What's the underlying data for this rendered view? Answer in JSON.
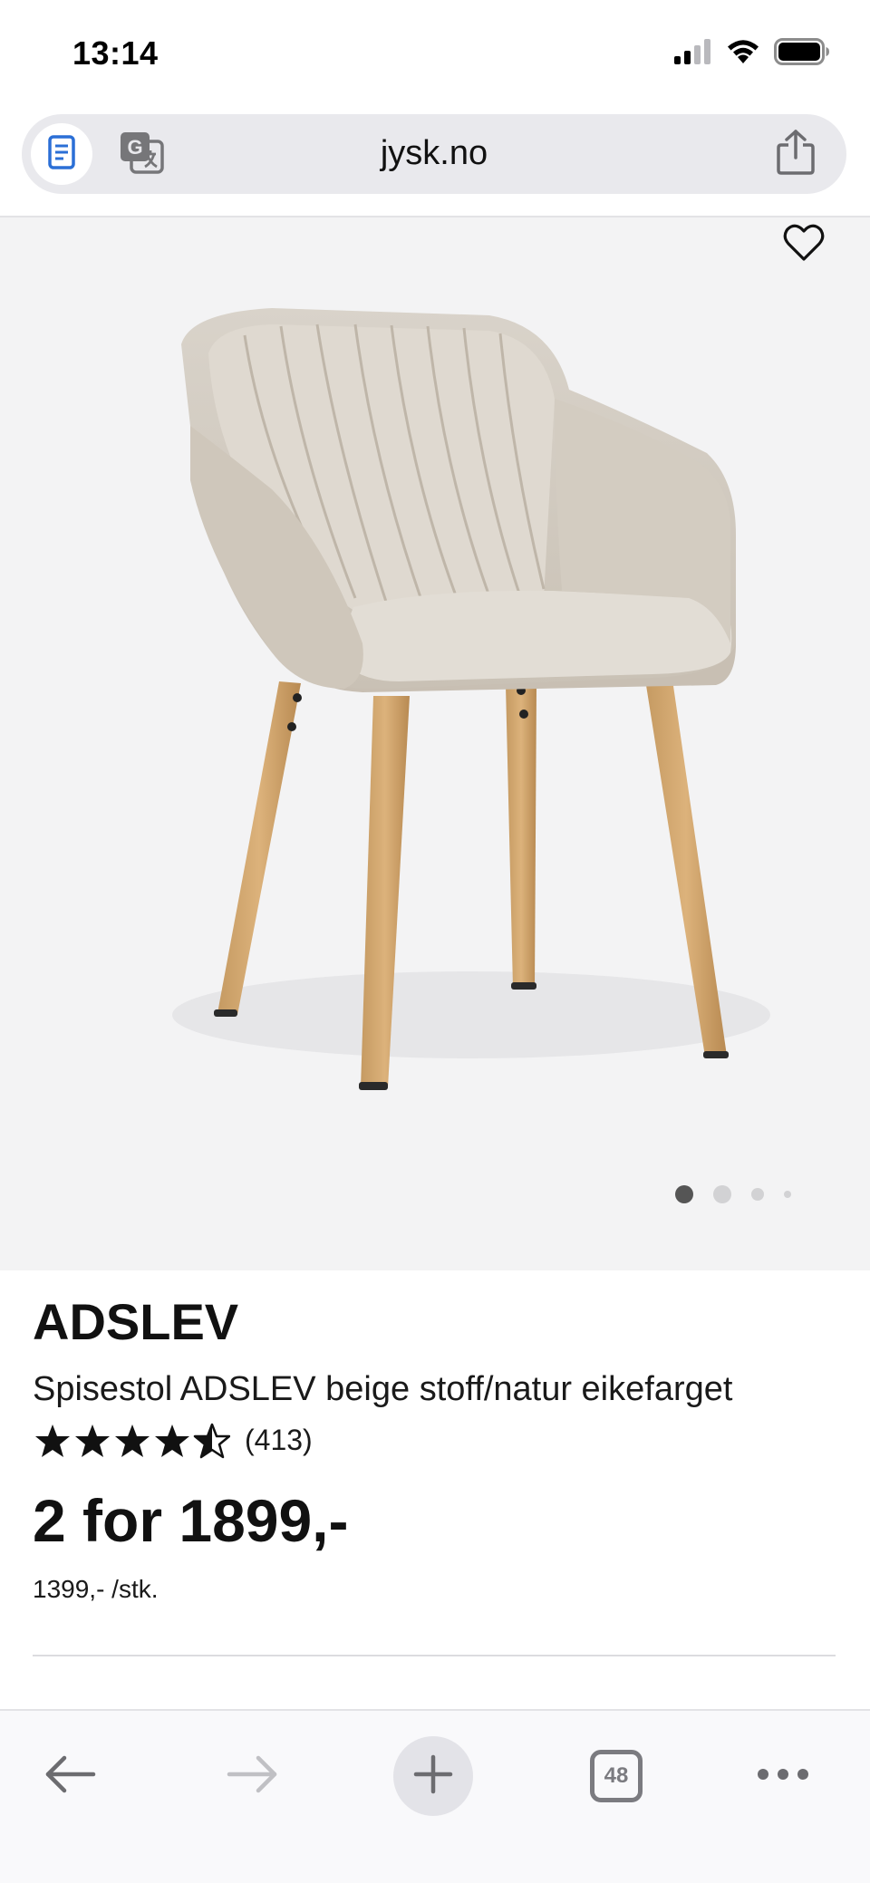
{
  "status_bar": {
    "time": "13:14",
    "icons": [
      "cellular-signal-icon",
      "wifi-icon",
      "battery-icon"
    ]
  },
  "browser": {
    "url": "jysk.no",
    "icons": {
      "reader": "reader-mode-icon",
      "translate": "translate-icon",
      "share": "share-icon"
    }
  },
  "product": {
    "name": "ADSLEV",
    "description": "Spisestol ADSLEV beige stoff/natur eikefarget",
    "rating_value": 4.5,
    "rating_max": 5,
    "rating_count": "(413)",
    "price_offer": "2 for 1899,-",
    "unit_price": "1399,- /stk.",
    "image_carousel": {
      "total": 4,
      "active_index": 0
    },
    "favorite_icon": "heart-icon"
  },
  "toolbar": {
    "tab_count": "48",
    "icons": [
      "back-arrow-icon",
      "forward-arrow-icon",
      "plus-icon",
      "tabs-icon",
      "more-icon"
    ]
  },
  "colors": {
    "accent_star": "#111111",
    "image_bg": "#f3f3f4",
    "url_bar_bg": "#e9e9ed",
    "reader_icon": "#2b6fd6"
  }
}
